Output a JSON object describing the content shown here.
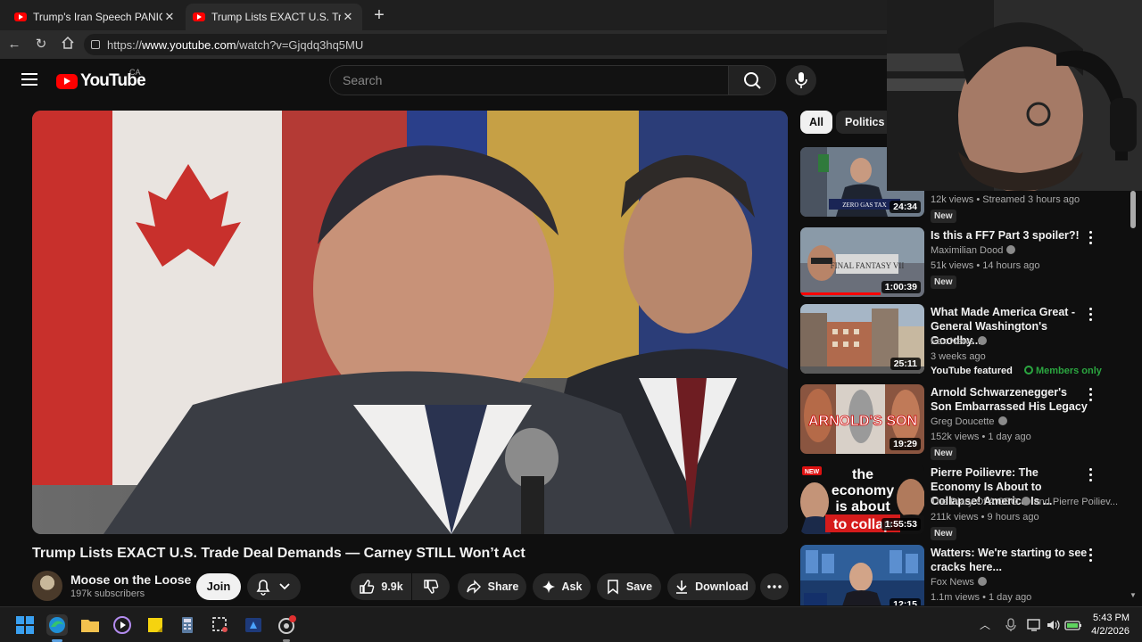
{
  "browser": {
    "tabs": [
      {
        "title": "Trump's Iran Speech PANICS The N",
        "active": false
      },
      {
        "title": "Trump Lists EXACT U.S. Trade Deal",
        "active": true
      }
    ],
    "url_prefix": "https://",
    "url_host": "www.youtube.com",
    "url_path": "/watch?v=Gjqdq3hq5MU"
  },
  "youtube": {
    "logo_text": "YouTube",
    "country_code": "CA",
    "search_placeholder": "Search",
    "video": {
      "title": "Trump Lists EXACT U.S. Trade Deal Demands — Carney STILL Won’t Act",
      "channel": "Moose on the Loose",
      "subscribers": "197k subscribers",
      "join_label": "Join",
      "likes": "9.9k",
      "share_label": "Share",
      "ask_label": "Ask",
      "save_label": "Save",
      "download_label": "Download"
    },
    "chips": [
      {
        "label": "All",
        "selected": true
      },
      {
        "label": "Politics n",
        "selected": false
      }
    ],
    "recommendations": [
      {
        "title": "",
        "channel": "",
        "meta": "12k views • Streamed 3 hours ago",
        "duration": "24:34",
        "badge": "New",
        "thumb_text": "ZERO GAS TAX"
      },
      {
        "title": "Is this a FF7 Part 3 spoiler?!",
        "channel": "Maximilian Dood",
        "meta": "51k views • 14 hours ago",
        "duration": "1:00:39",
        "badge": "New",
        "thumb_text": "FINAL FANTASY VII"
      },
      {
        "title": "What Made America Great - General Washington's Goodby...",
        "channel": "Fox News",
        "meta": "3 weeks ago",
        "duration": "25:11",
        "featured": "YouTube featured",
        "members": "Members only"
      },
      {
        "title": "Arnold Schwarzenegger's Son Embarrassed His Legacy",
        "channel": "Greg Doucette",
        "meta": "152k views • 1 day ago",
        "duration": "19:29",
        "badge": "New",
        "thumb_text": "ARNOLD'S SON"
      },
      {
        "title": "Pierre Poilievre: The Economy Is About to Collapse! America Is ...",
        "channel": "The Diary Of A CEO",
        "channel_extra": "and Pierre Poiliev...",
        "meta": "211k views • 9 hours ago",
        "duration": "1:55:53",
        "badge": "New",
        "thumb_text": [
          "the",
          "economy",
          "is about",
          "to collap"
        ],
        "thumb_new": "NEW"
      },
      {
        "title": "Watters: We're starting to see cracks here...",
        "channel": "Fox News",
        "meta": "1.1m views • 1 day ago",
        "duration": "12:15"
      }
    ]
  },
  "taskbar": {
    "time": "5:43 PM",
    "date": "4/2/2026"
  },
  "colors": {
    "yt_red": "#ff0000",
    "bg": "#0f0f0f",
    "members_green": "#2ba640"
  }
}
